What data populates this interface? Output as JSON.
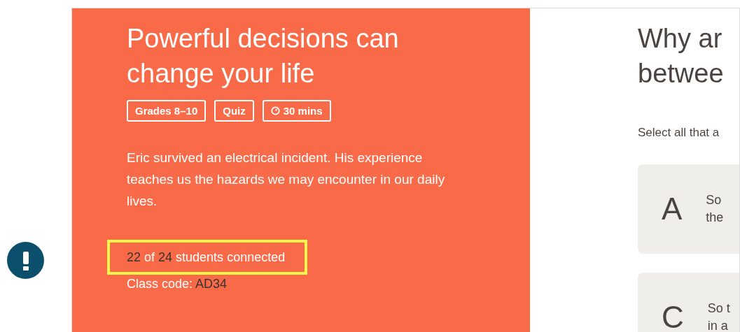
{
  "lesson": {
    "title_lines": [
      "Powerful decisions can",
      "change your life"
    ],
    "tags": [
      {
        "kind": "text",
        "label": "Grades 8–10"
      },
      {
        "kind": "text",
        "label": "Quiz"
      },
      {
        "kind": "time",
        "label": "30 mins"
      }
    ],
    "description": "Eric survived an electrical incident. His experience teaches us the hazards we may encounter in our daily lives.",
    "connection": [
      {
        "kind": "number",
        "text": "22"
      },
      {
        "kind": "word",
        "text": "of"
      },
      {
        "kind": "number",
        "text": "24"
      },
      {
        "kind": "word",
        "text": "students connected"
      }
    ],
    "class_code_label": "Class code:",
    "class_code": "AD34"
  },
  "question": {
    "title_lines": [
      "Why ar",
      "betwee"
    ],
    "instruction": "Select all that a",
    "options": [
      {
        "letter": "A",
        "lines": [
          "So",
          "the"
        ]
      },
      {
        "letter": "C",
        "lines": [
          "So t",
          "in a"
        ]
      }
    ]
  }
}
